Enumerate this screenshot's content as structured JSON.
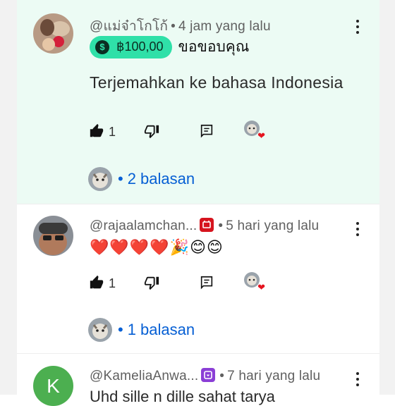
{
  "comments": [
    {
      "author": "@แม่จ๋าโกโก้",
      "time": "4 jam yang lalu",
      "thanks_amount": "฿100,00",
      "thanks_text": "ขอขอบคุณ",
      "text": "Terjemahkan ke bahasa Indonesia",
      "likes": "1",
      "replies_label": "2 balasan"
    },
    {
      "author": "@rajaalamchan...",
      "time": "5 hari yang lalu",
      "text": "❤️❤️❤️❤️🎉😊😊",
      "likes": "1",
      "replies_label": "1 balasan"
    },
    {
      "author": "@KameliaAnwa...",
      "time": "7 hari yang lalu",
      "avatar_letter": "K",
      "text": "Uhd sille n dille sahat tarya"
    }
  ],
  "colors": {
    "highlight_bg": "#ecfbf4",
    "thanks_badge": "#2fe0a8",
    "reply_link": "#065fd4",
    "member_badge_red": "#d6141e",
    "member_badge_purple": "#8b3fd6",
    "avatar_green": "#4caf50"
  },
  "icons": [
    "like-icon",
    "dislike-icon",
    "reply-icon",
    "more-vert-icon",
    "super-thanks-coin-icon",
    "creator-heart-icon",
    "member-badge-icon"
  ]
}
